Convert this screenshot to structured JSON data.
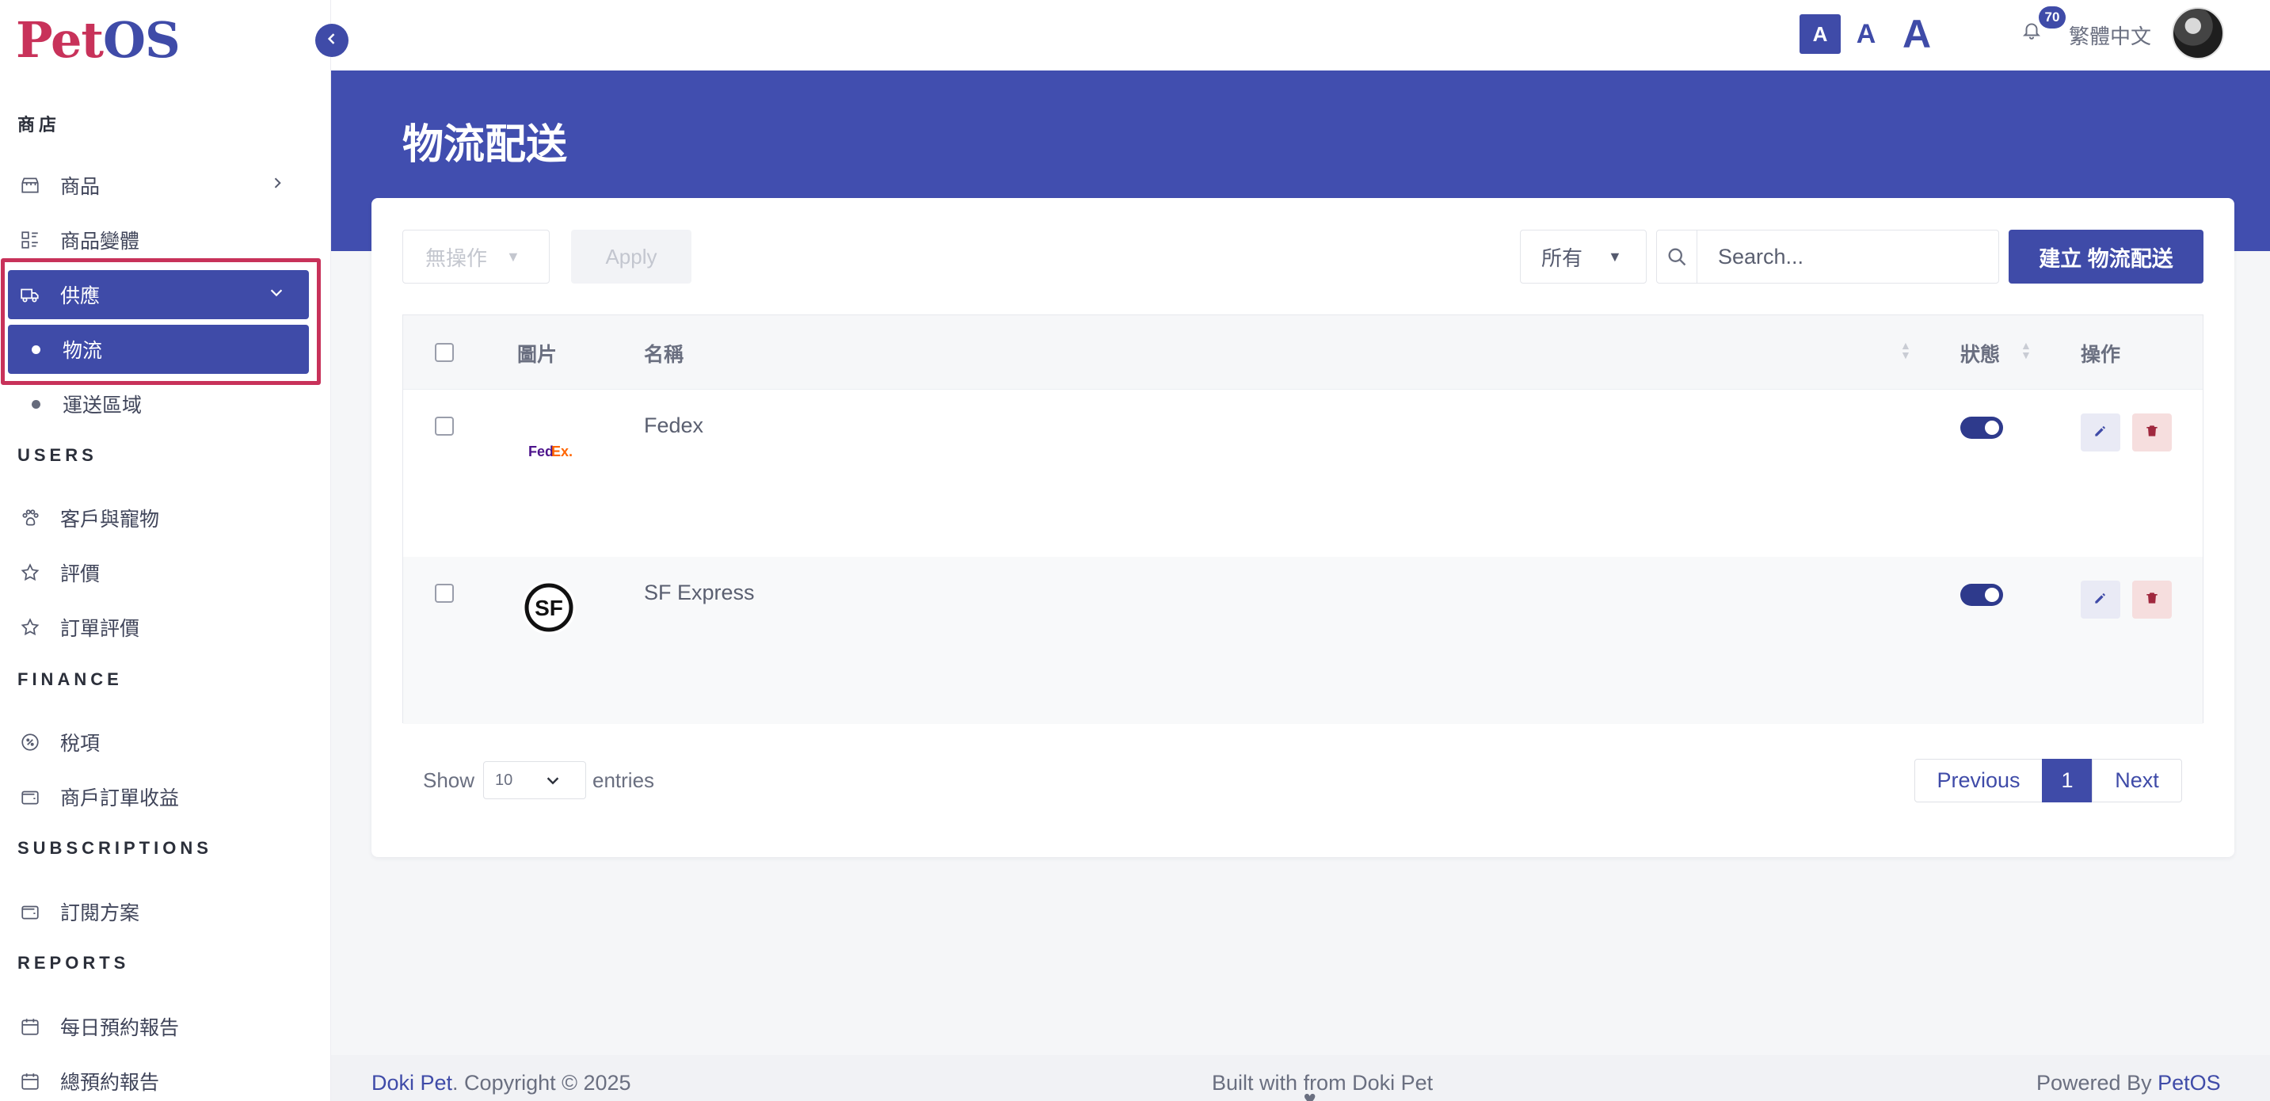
{
  "brand": {
    "logo_pet": "Pet",
    "logo_os": "OS"
  },
  "topbar": {
    "font_sizes": [
      "A",
      "A",
      "A"
    ],
    "notification_count": "70",
    "language": "繁體中文"
  },
  "sidebar": {
    "sections": {
      "shop": "商店",
      "users": "USERS",
      "finance": "FINANCE",
      "subscriptions": "SUBSCRIPTIONS",
      "reports": "REPORTS"
    },
    "items": {
      "products": "商品",
      "product_variants": "商品變體",
      "supply": "供應",
      "logistics": "物流",
      "shipping_zones": "運送區域",
      "customers_pets": "客戶與寵物",
      "reviews": "評價",
      "order_reviews": "訂單評價",
      "tax": "稅項",
      "merchant_revenue": "商戶訂單收益",
      "subscription_plans": "訂閱方案",
      "daily_booking_report": "每日預約報告",
      "total_booking_report": "總預約報告"
    }
  },
  "page": {
    "title": "物流配送",
    "bulk_action": "無操作",
    "apply_label": "Apply",
    "filter_value": "所有",
    "search_placeholder": "Search...",
    "create_label": "建立 物流配送"
  },
  "table": {
    "headers": {
      "image": "圖片",
      "name": "名稱",
      "status": "狀態",
      "actions": "操作"
    },
    "rows": [
      {
        "name": "Fedex",
        "logo_text_a": "Fed",
        "logo_text_b": "Ex",
        "logo_suffix": ".",
        "enabled": true
      },
      {
        "name": "SF Express",
        "logo_text": "SF",
        "enabled": true
      }
    ]
  },
  "pagination": {
    "show_label": "Show",
    "page_size": "10",
    "entries_label": "entries",
    "previous": "Previous",
    "current_page": "1",
    "next": "Next"
  },
  "footer": {
    "company": "Doki Pet",
    "copyright": ". Copyright © 2025",
    "built_prefix": "Built with",
    "built_suffix": "from Doki Pet",
    "powered_prefix": "Powered By",
    "powered_brand": "PetOS"
  },
  "colors": {
    "primary": "#3f4ba8",
    "brand_red": "#c8325a",
    "banner": "#414eaf"
  }
}
